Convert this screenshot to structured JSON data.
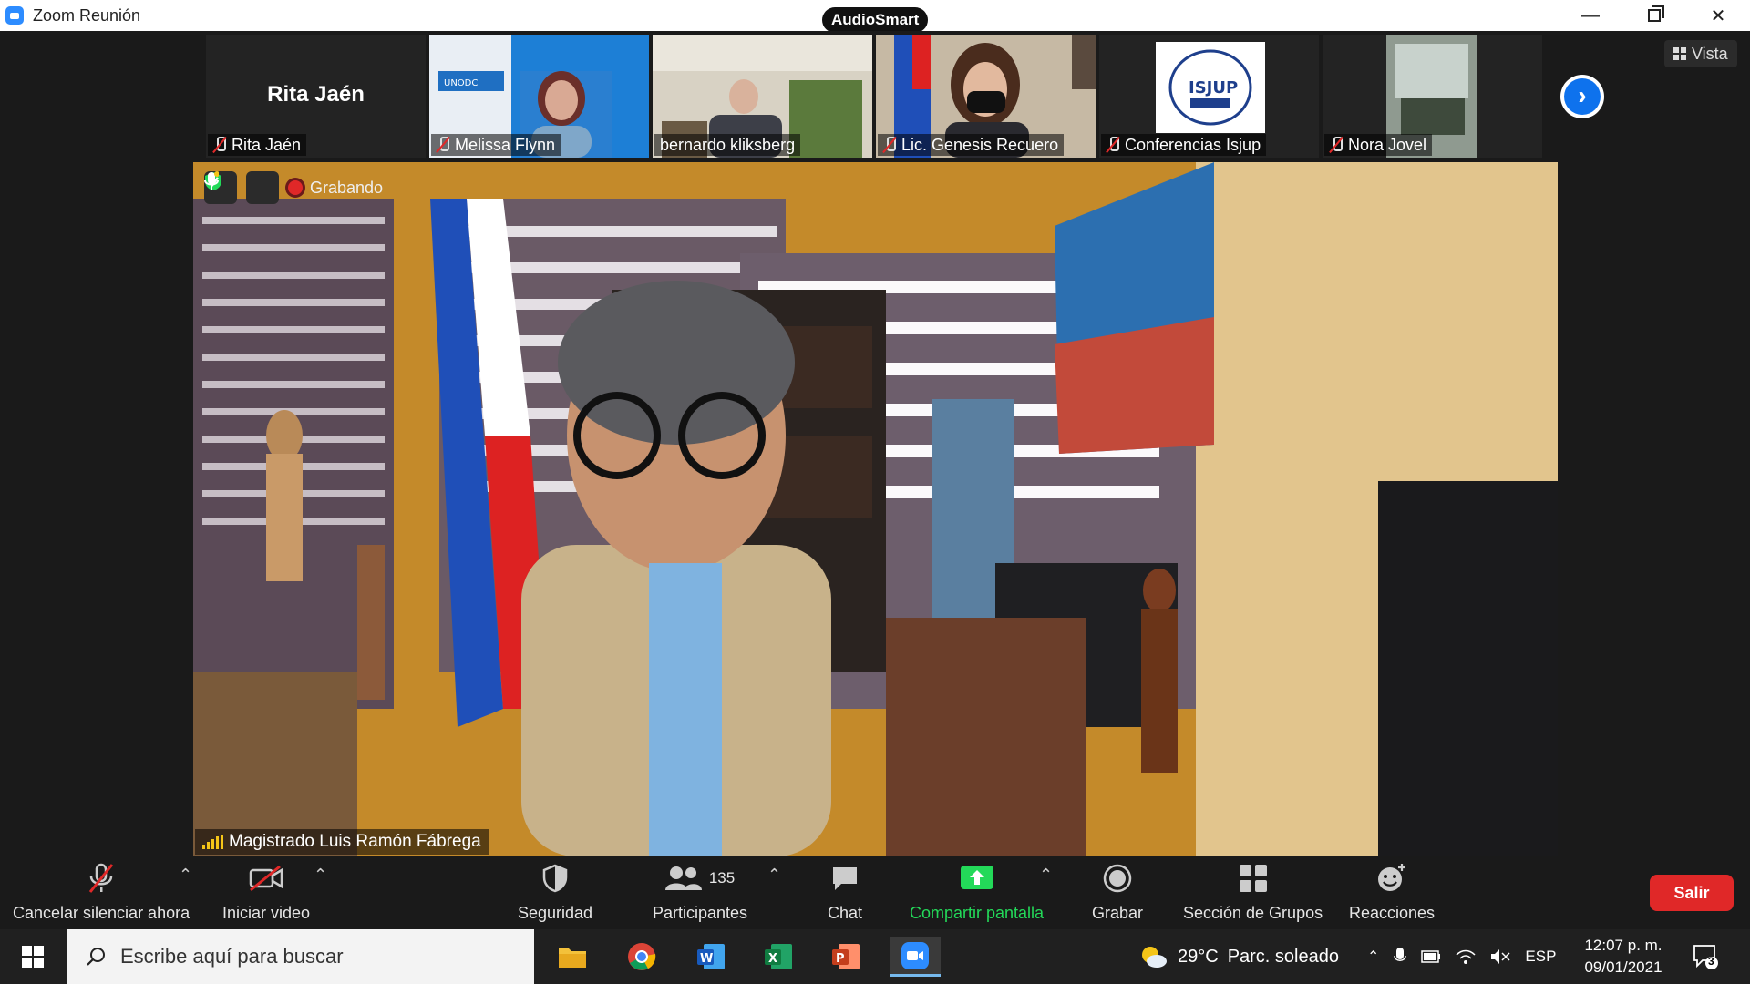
{
  "window": {
    "title": "Zoom Reunión",
    "audio_badge": "AudioSmart",
    "controls": [
      "minimize-icon",
      "restore-icon",
      "close-icon"
    ]
  },
  "gallery": {
    "tiles": [
      {
        "name": "Rita Jaén",
        "big_name": "Rita Jaén",
        "muted": true,
        "video": false
      },
      {
        "name": "Melissa Flynn",
        "muted": true,
        "video": true
      },
      {
        "name": "bernardo kliksberg",
        "muted": false,
        "video": true
      },
      {
        "name": "Lic. Genesis Recuero",
        "muted": true,
        "video": true
      },
      {
        "name": "Conferencias Isjup",
        "muted": true,
        "video": true
      },
      {
        "name": "Nora Jovel",
        "muted": true,
        "video": true
      }
    ],
    "next_icon": "chevron-right-icon",
    "view_button": "Vista"
  },
  "speaker": {
    "name": "Magistrado Luis Ramón Fábrega",
    "recording_label": "Grabando",
    "security_icon": "shield-check-icon",
    "mic_icon": "microphone-icon"
  },
  "toolbar": {
    "unmute": "Cancelar silenciar ahora",
    "start_video": "Iniciar video",
    "security": "Seguridad",
    "participants": "Participantes",
    "participants_count": "135",
    "chat": "Chat",
    "share_screen": "Compartir pantalla",
    "record": "Grabar",
    "breakout": "Sección de Grupos",
    "reactions": "Reacciones",
    "exit": "Salir"
  },
  "taskbar": {
    "search_placeholder": "Escribe aquí para buscar",
    "apps": [
      "file-explorer-icon",
      "chrome-icon",
      "word-icon",
      "excel-icon",
      "powerpoint-icon",
      "zoom-icon"
    ],
    "weather_temp": "29°C",
    "weather_text": "Parc. soleado",
    "language": "ESP",
    "time": "12:07 p. m.",
    "date": "09/01/2021",
    "notifications": "3"
  },
  "colors": {
    "zoom_blue": "#0e72ed",
    "exit_red": "#e02828",
    "share_green": "#23d959",
    "toolbar_bg": "#1a1a1a"
  }
}
